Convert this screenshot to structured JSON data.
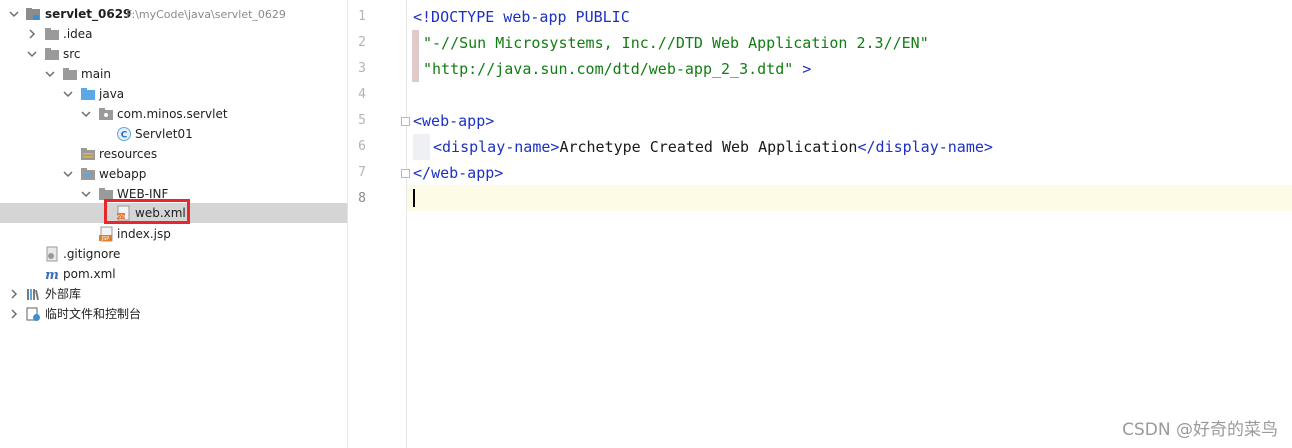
{
  "project": {
    "root_name": "servlet_0629",
    "root_path": "F:\\myCode\\java\\servlet_0629",
    "idea": ".idea",
    "src": "src",
    "main": "main",
    "java": "java",
    "package": "com.minos.servlet",
    "servlet_class": "Servlet01",
    "resources": "resources",
    "webapp": "webapp",
    "web_inf": "WEB-INF",
    "web_xml": "web.xml",
    "index_jsp": "index.jsp",
    "gitignore": ".gitignore",
    "pom": "pom.xml",
    "external_libs": "外部库",
    "scratches": "临时文件和控制台"
  },
  "icons": {
    "root": "module-folder-icon",
    "folder": "folder-icon",
    "source_folder": "source-root-icon",
    "package": "package-icon",
    "class": "class-icon",
    "resources": "resources-root-icon",
    "web": "web-folder-icon",
    "xml": "xml-file-icon",
    "jsp": "jsp-file-icon",
    "gitignore": "ignore-file-icon",
    "maven": "maven-icon",
    "libraries": "library-icon",
    "scratches": "scratches-icon"
  },
  "colors": {
    "xml_tag": "#1c31c4",
    "string": "#127d12",
    "highlight": "#e8262c",
    "selection": "#d5d5d5",
    "caret_line": "#fdfae6"
  },
  "editor": {
    "line_numbers": [
      "1",
      "2",
      "3",
      "4",
      "5",
      "6",
      "7",
      "8"
    ],
    "l1": "<!DOCTYPE web-app PUBLIC",
    "l2": "\"-//Sun Microsystems, Inc.//DTD Web Application 2.3//EN\"",
    "l3_str": "\"http://java.sun.com/dtd/web-app_2_3.dtd\"",
    "l3_end": " >",
    "l5_open": "<",
    "l5_tag": "web-app",
    "l5_close": ">",
    "l6_open": "<",
    "l6_tag": "display-name",
    "l6_close": ">",
    "l6_text": "Archetype Created Web Application",
    "l6_end_open": "</",
    "l6_end_tag": "display-name",
    "l6_end_close": ">",
    "l7_open": "</",
    "l7_tag": "web-app",
    "l7_close": ">"
  },
  "watermark": "CSDN @好奇的菜鸟"
}
